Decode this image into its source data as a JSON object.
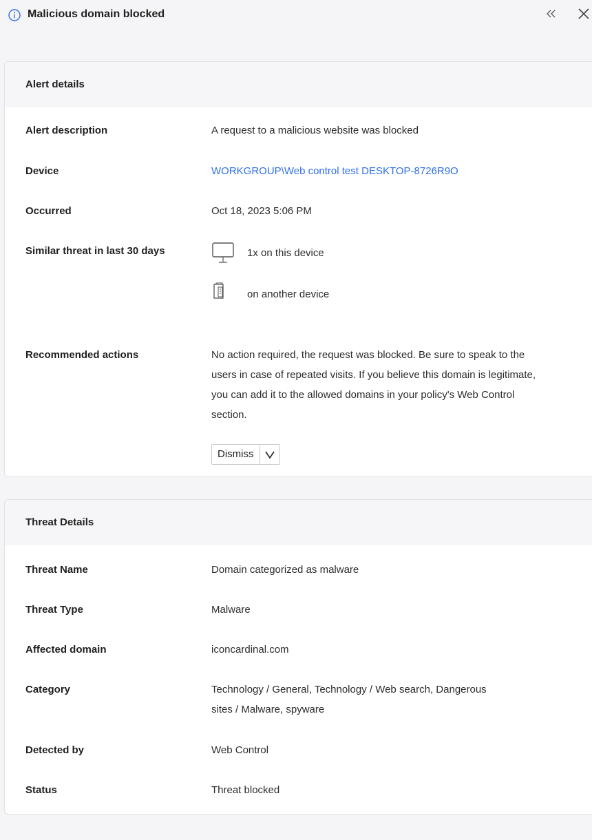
{
  "header": {
    "title": "Malicious domain blocked",
    "collapse_glyph": "«",
    "close_glyph": "✕"
  },
  "alert_details": {
    "section_title": "Alert details",
    "description_label": "Alert description",
    "description_value": "A request to a malicious website was blocked",
    "device_label": "Device",
    "device_value": "WORKGROUP\\Web control test DESKTOP-8726R9O",
    "occurred_label": "Occurred",
    "occurred_value": "Oct 18, 2023 5:06 PM",
    "similar_label": "Similar threat in last 30 days",
    "similar_this_device": "1x on this device",
    "similar_other_device": "on another device",
    "recommended_label": "Recommended actions",
    "recommended_value": "No action required, the request was blocked. Be sure to speak to the users in case of repeated visits. If you believe this domain is legitimate, you can add it to the allowed domains in your policy's Web Control section.",
    "dismiss_label": "Dismiss"
  },
  "threat_details": {
    "section_title": "Threat Details",
    "rows": [
      {
        "label": "Threat Name",
        "value": "Domain categorized as malware"
      },
      {
        "label": "Threat Type",
        "value": "Malware"
      },
      {
        "label": "Affected domain",
        "value": "iconcardinal.com"
      },
      {
        "label": "Category",
        "value": "Technology / General, Technology / Web search, Dangerous sites / Malware, spyware"
      },
      {
        "label": "Detected by",
        "value": "Web Control"
      },
      {
        "label": "Status",
        "value": "Threat blocked"
      }
    ]
  },
  "colors": {
    "link": "#2d6fe6",
    "info_icon": "#2d6fe6",
    "header_bg": "#f6f6f8"
  }
}
